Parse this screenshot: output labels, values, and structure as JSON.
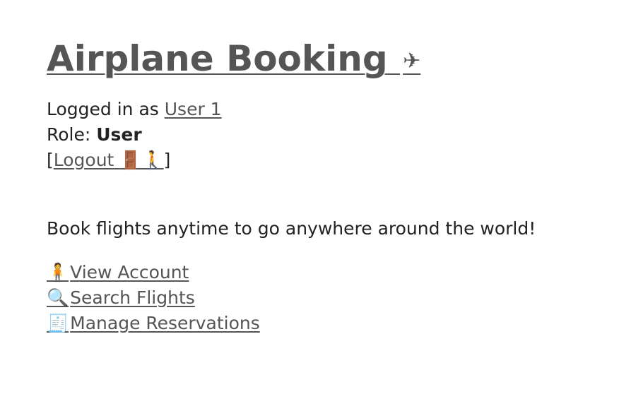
{
  "header": {
    "title": "Airplane Booking",
    "title_icon": "✈"
  },
  "session": {
    "logged_in_prefix": "Logged in as ",
    "username": "User 1",
    "role_prefix": "Role: ",
    "role": "User",
    "logout_open": "[",
    "logout_label": "Logout",
    "logout_icon": "🚪🚶",
    "logout_close": "]"
  },
  "tagline": "Book flights anytime to go anywhere around the world!",
  "nav": {
    "items": [
      {
        "icon": "🧍",
        "label": "View Account"
      },
      {
        "icon": "🔍",
        "label": "Search Flights"
      },
      {
        "icon": "🧾",
        "label": "Manage Reservations"
      }
    ]
  }
}
